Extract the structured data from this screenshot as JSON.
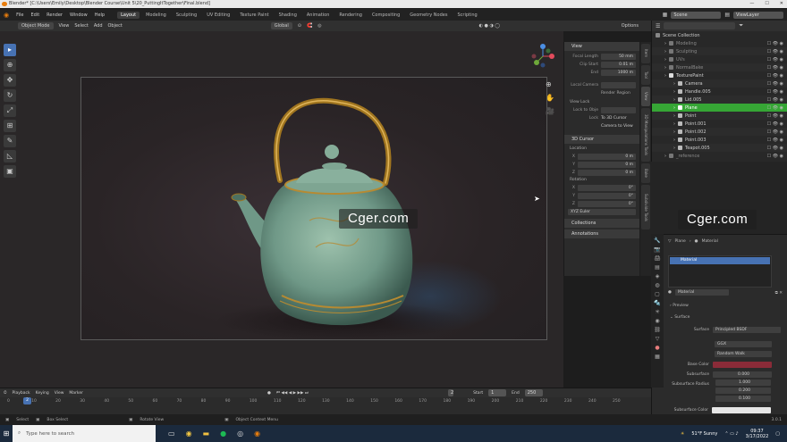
{
  "window": {
    "title": "Blender* [C:\\Users\\Emily\\Desktop\\Blender Course\\Unit 5\\20_PuttingItTogether\\Final.blend]",
    "controls": [
      "—",
      "☐",
      "✕"
    ]
  },
  "menubar": {
    "menus": [
      "File",
      "Edit",
      "Render",
      "Window",
      "Help"
    ],
    "workspaces": [
      "Layout",
      "Modeling",
      "Sculpting",
      "UV Editing",
      "Texture Paint",
      "Shading",
      "Animation",
      "Rendering",
      "Compositing",
      "Geometry Nodes",
      "Scripting"
    ],
    "active_workspace": "Layout",
    "scene": "Scene",
    "view_layer": "ViewLayer"
  },
  "viewport_header": {
    "mode": "Object Mode",
    "menus": [
      "View",
      "Select",
      "Add",
      "Object"
    ],
    "transform": "Global",
    "options": "Options"
  },
  "toolbar": {
    "tools": [
      {
        "name": "select-box-icon",
        "glyph": "▸"
      },
      {
        "name": "cursor-icon",
        "glyph": "⊕"
      },
      {
        "name": "move-icon",
        "glyph": "✥"
      },
      {
        "name": "rotate-icon",
        "glyph": "↻"
      },
      {
        "name": "scale-icon",
        "glyph": "⤢"
      },
      {
        "name": "transform-icon",
        "glyph": "⊞"
      },
      {
        "name": "annotate-icon",
        "glyph": "✎"
      },
      {
        "name": "measure-icon",
        "glyph": "◺"
      },
      {
        "name": "add-cube-icon",
        "glyph": "▣"
      }
    ]
  },
  "npanel": {
    "view_header": "View",
    "focal_length_label": "Focal Length",
    "focal_length": "50 mm",
    "clip_start_label": "Clip Start",
    "clip_start": "0.01 m",
    "end_label": "End",
    "end": "1000 m",
    "local_camera_label": "Local Camera",
    "render_region": "Render Region",
    "view_lock_header": "View Lock",
    "lock_to_object_label": "Lock to Obje",
    "lock_label": "Lock",
    "to_3d_cursor": "To 3D Cursor",
    "camera_to_view": "Camera to View",
    "cursor_header": "3D Cursor",
    "location_label": "Location",
    "loc_x": "0 m",
    "loc_y": "0 m",
    "loc_z": "0 m",
    "rotation_label": "Rotation",
    "rot_x": "0°",
    "rot_y": "0°",
    "rot_z": "0°",
    "rotation_mode": "XYZ Euler",
    "collections": "Collections",
    "annotations": "Annotations"
  },
  "sidetabs": [
    "Item",
    "Tool",
    "View",
    "3D Manipulations Tools",
    "Bake",
    "Subdivide Tools"
  ],
  "outliner": {
    "root": "Scene Collection",
    "rows": [
      {
        "label": "Modeling",
        "indent": 1,
        "color": "#777777",
        "dim": true
      },
      {
        "label": "Sculpting",
        "indent": 1,
        "color": "#777777",
        "dim": true
      },
      {
        "label": "UVs",
        "indent": 1,
        "color": "#777777",
        "dim": true
      },
      {
        "label": "NormalBake",
        "indent": 1,
        "color": "#777777",
        "dim": true
      },
      {
        "label": "TexturePaint",
        "indent": 1,
        "color": "#dddddd",
        "dim": false
      },
      {
        "label": "Camera",
        "indent": 2,
        "color": "#bbbbbb",
        "dim": false
      },
      {
        "label": "Handle.005",
        "indent": 2,
        "color": "#bbbbbb",
        "dim": false
      },
      {
        "label": "Lid.005",
        "indent": 2,
        "color": "#bbbbbb",
        "dim": false
      },
      {
        "label": "Plane",
        "indent": 2,
        "color": "#ffffff",
        "dim": false,
        "selected": true
      },
      {
        "label": "Point",
        "indent": 2,
        "color": "#bbbbbb",
        "dim": false
      },
      {
        "label": "Point.001",
        "indent": 2,
        "color": "#bbbbbb",
        "dim": false
      },
      {
        "label": "Point.002",
        "indent": 2,
        "color": "#bbbbbb",
        "dim": false
      },
      {
        "label": "Point.003",
        "indent": 2,
        "color": "#bbbbbb",
        "dim": false
      },
      {
        "label": "Teapot.005",
        "indent": 2,
        "color": "#bbbbbb",
        "dim": false
      },
      {
        "label": "_reference",
        "indent": 1,
        "color": "#777777",
        "dim": true
      }
    ]
  },
  "properties": {
    "breadcrumb_object": "Plane",
    "breadcrumb_tab": "Material",
    "slot": "Material",
    "material_name": "Material",
    "preview": "Preview",
    "surface_header": "Surface",
    "surface_label": "Surface",
    "surface_value": "Principled BSDF",
    "distribution": "GGX",
    "subsurface_method": "Random Walk",
    "base_color_label": "Base Color",
    "base_color": "#8a2b38",
    "subsurface_label": "Subsurface",
    "subsurface_value": "0.000",
    "subsurface_radius_label": "Subsurface Radius",
    "radius": [
      "1.000",
      "0.200",
      "0.100"
    ],
    "subsurface_color_label": "Subsurface Color"
  },
  "timeline": {
    "menus": [
      "Playback",
      "Keying",
      "View",
      "Marker"
    ],
    "current_frame": "2",
    "start_label": "Start",
    "start": "1",
    "end_label": "End",
    "end": "250",
    "ruler": [
      "0",
      "10",
      "20",
      "30",
      "40",
      "50",
      "60",
      "70",
      "80",
      "90",
      "100",
      "110",
      "120",
      "130",
      "140",
      "150",
      "160",
      "170",
      "180",
      "190",
      "200",
      "210",
      "220",
      "230",
      "240",
      "250"
    ],
    "playhead": "2"
  },
  "statusbar": {
    "items": [
      "Select",
      "Box Select",
      "Rotate View",
      "Object Context Menu"
    ],
    "version": "3.0.1"
  },
  "taskbar": {
    "search_placeholder": "Type here to search",
    "weather": "51°F  Sunny",
    "time": "09:37",
    "date": "3/17/2022"
  },
  "watermarks": [
    "Cger.com",
    "Cger.com"
  ]
}
